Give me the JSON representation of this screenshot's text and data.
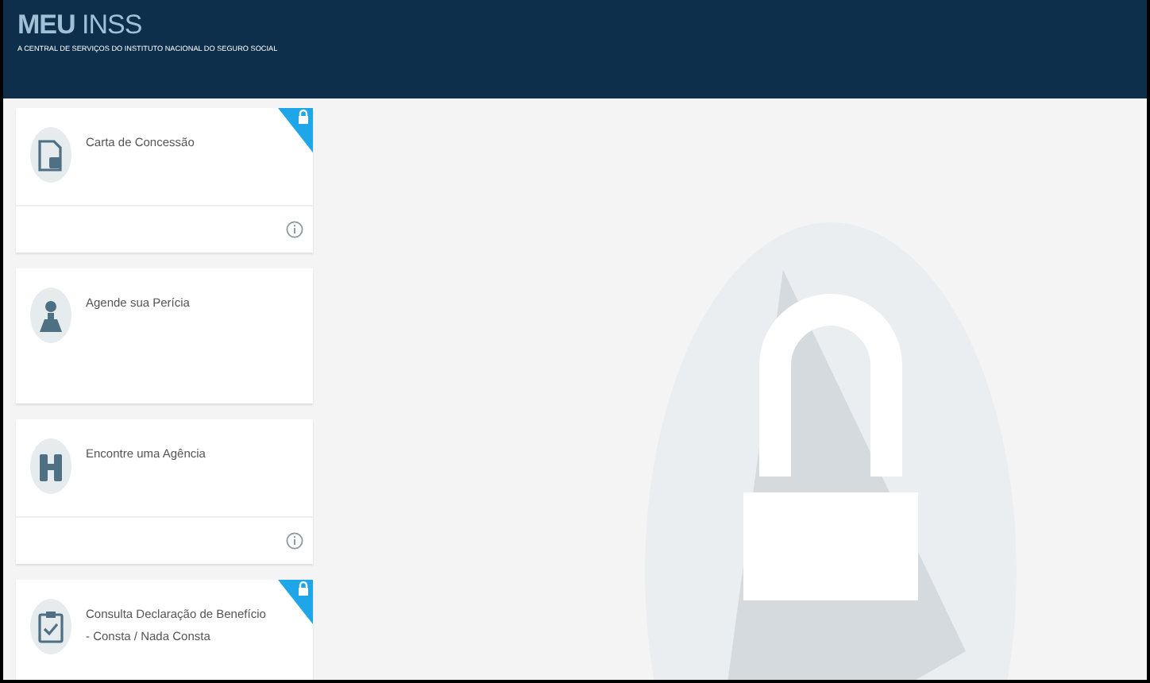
{
  "header": {
    "title": "**MEU** INSS",
    "subtitle": "A CENTRAL DE SERVIÇOS DO INSTITUTO NACIONAL DO SEGURO SOCIAL"
  },
  "cards": [
    {
      "label": "Carta de Concessão",
      "kind": "document",
      "locked": true,
      "info": true
    },
    {
      "label": "Agende sua Perícia",
      "kind": "person",
      "locked": false,
      "info": false
    },
    {
      "label": "Encontre uma Agência",
      "kind": "binoculars",
      "locked": false,
      "info": true
    },
    {
      "label": "Consulta Declaração de Benefício - Consta / Nada Consta",
      "kind": "clipboard",
      "locked": true,
      "info": false
    }
  ]
}
